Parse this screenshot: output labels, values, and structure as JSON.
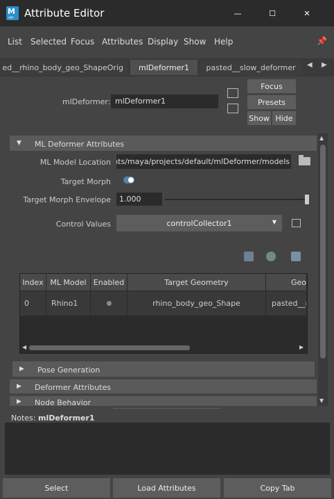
{
  "window": {
    "title": "Attribute Editor",
    "app_icon_letter": "M",
    "app_icon_sub": "APP",
    "minimize_glyph": "—",
    "maximize_glyph": "☐",
    "close_glyph": "✕"
  },
  "menu": [
    "List",
    "Selected",
    "Focus",
    "Attributes",
    "Display",
    "Show",
    "Help"
  ],
  "tabs": [
    {
      "label": "ed__rhino_body_geo_ShapeOrig",
      "active": false
    },
    {
      "label": "mlDeformer1",
      "active": true
    },
    {
      "label": "pasted__slow_deformer",
      "active": false
    }
  ],
  "tab_nav": {
    "prev": "◀",
    "next": "▶"
  },
  "node": {
    "label": "mlDeformer:",
    "value": "mlDeformer1",
    "buttons": {
      "focus": "Focus",
      "presets": "Presets",
      "show": "Show",
      "hide": "Hide"
    }
  },
  "sections": {
    "ml": {
      "label": "ML Deformer Attributes",
      "expanded": true,
      "arrow": "▼"
    },
    "pose": {
      "label": "Pose Generation",
      "expanded": false,
      "arrow": "▶"
    },
    "deformer": {
      "label": "Deformer Attributes",
      "expanded": false,
      "arrow": "▶"
    },
    "node_behavior": {
      "label": "Node Behavior",
      "expanded": false,
      "arrow": "▶"
    }
  },
  "attributes": {
    "model_location": {
      "label": "ML Model Location",
      "value": "C:/Users/Documents/maya/projects/default/mlDeformer/models"
    },
    "target_morph": {
      "label": "Target Morph",
      "enabled": true
    },
    "target_morph_envelope": {
      "label": "Target Morph Envelope",
      "value": "1.000",
      "slider_level": 1.0
    },
    "control_values": {
      "label": "Control Values",
      "value": "controlCollector1",
      "caret": "▼"
    }
  },
  "table": {
    "columns": [
      "Index",
      "ML Model",
      "Enabled",
      "Target Geometry",
      "Geo"
    ],
    "rows": [
      {
        "index": "0",
        "ml_model": "Rhino1",
        "enabled": false,
        "target_geometry": "rhino_body_geo_Shape",
        "geo": "pasted__r"
      }
    ],
    "scroll_left": "◀",
    "scroll_right": "▶"
  },
  "vscroll": {
    "up": "▲",
    "down": "▼"
  },
  "notes": {
    "label": "Notes:",
    "node": "mlDeformer1",
    "text": ""
  },
  "bottom_buttons": {
    "select": "Select",
    "load": "Load Attributes",
    "copy": "Copy Tab"
  },
  "colors": {
    "accent": "#5285a6",
    "background": "#444444",
    "field": "#2b2b2b",
    "button": "#5d5d5d"
  }
}
